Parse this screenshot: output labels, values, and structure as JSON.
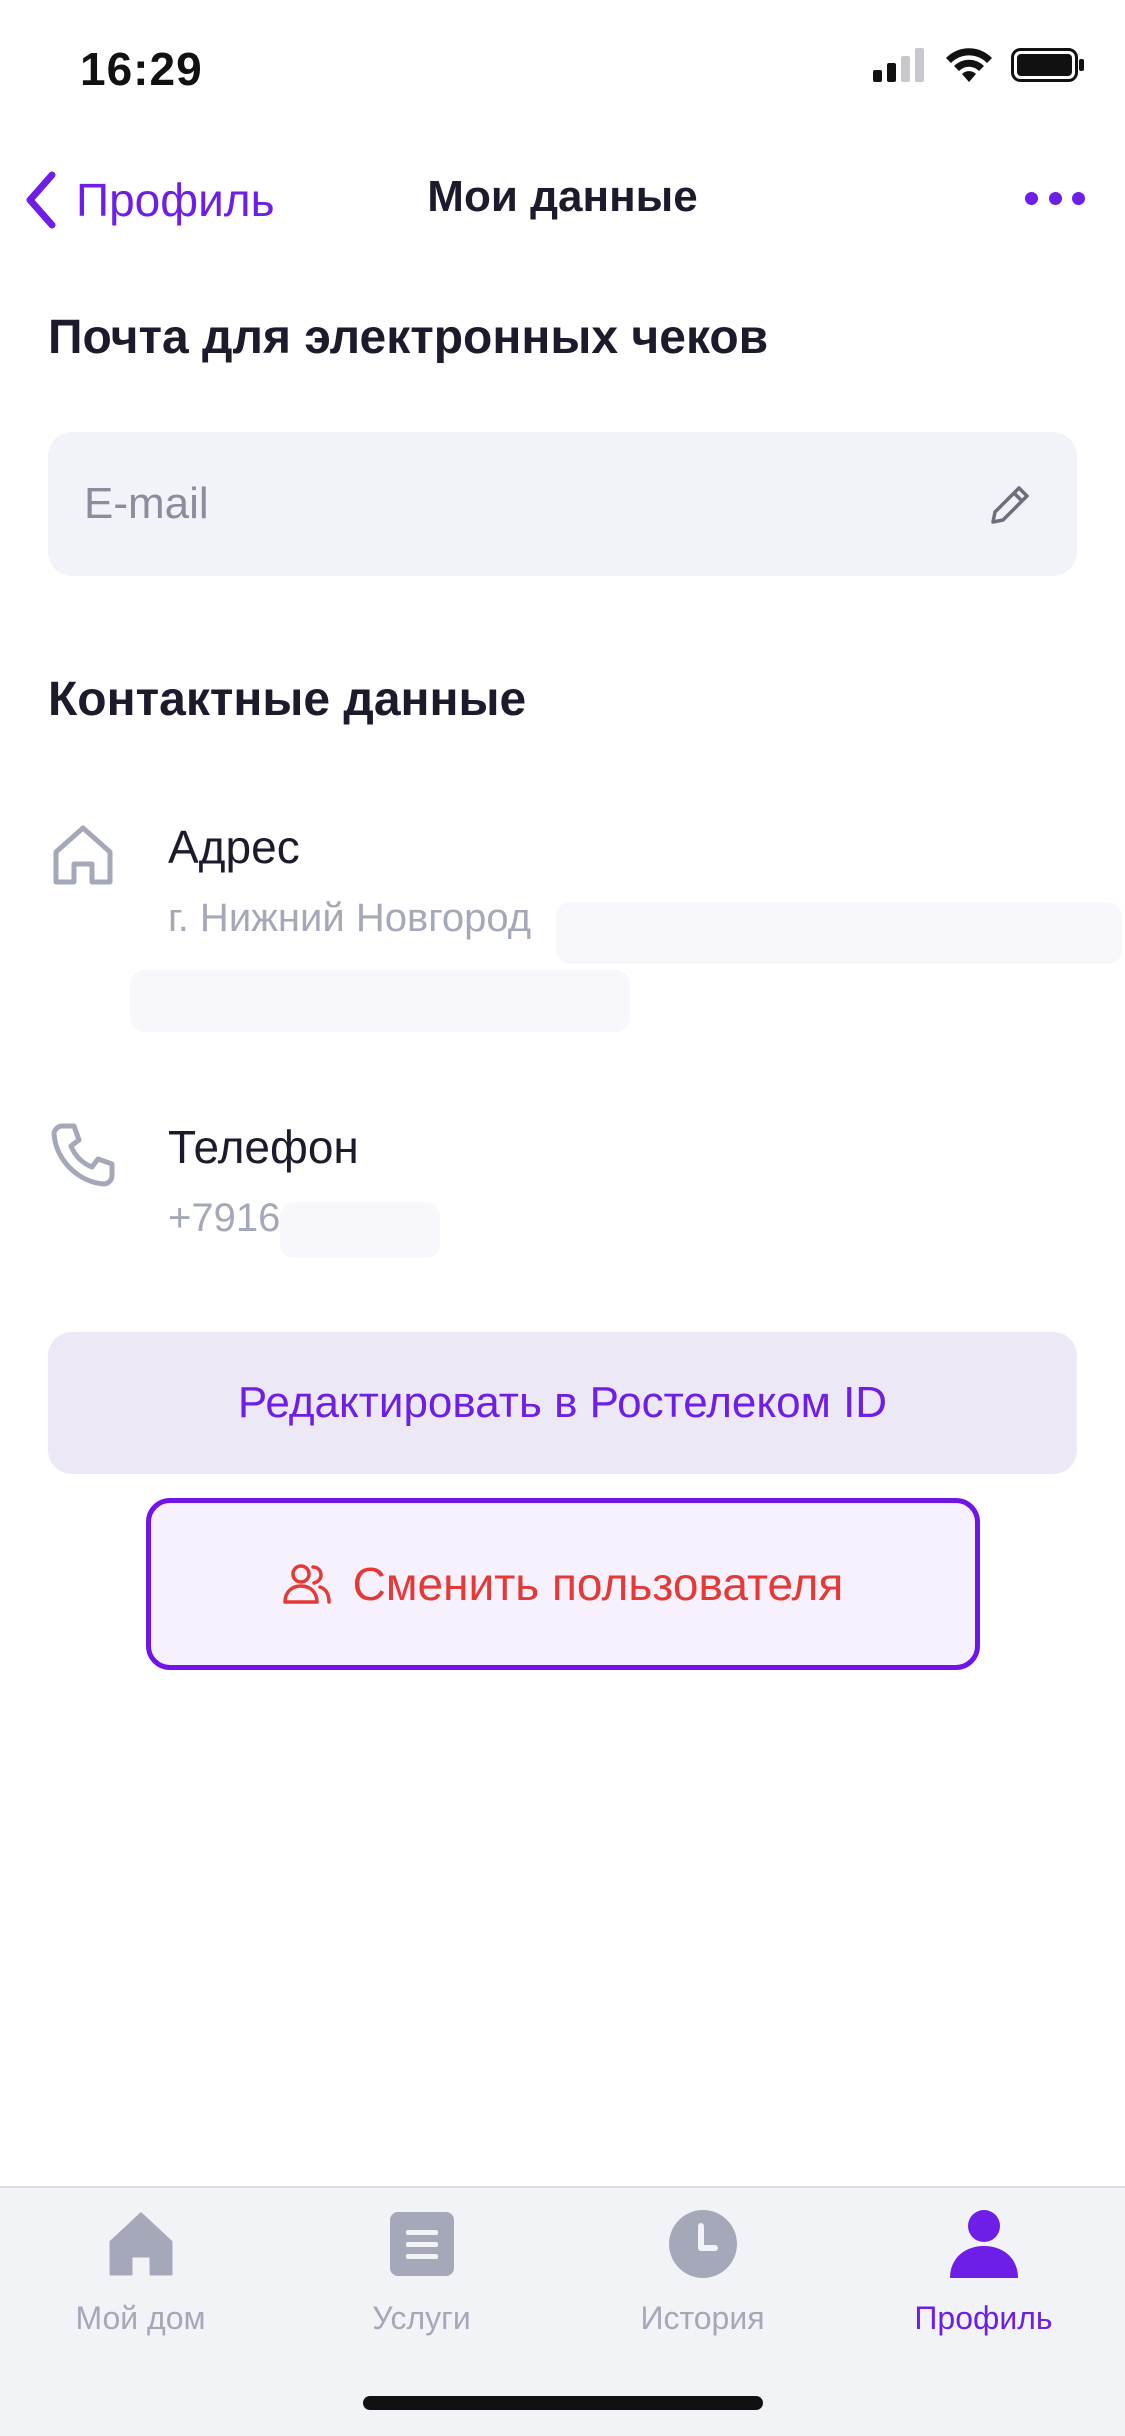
{
  "status_bar": {
    "time": "16:29"
  },
  "nav": {
    "back_label": "Профиль",
    "title": "Мои данные"
  },
  "receipts": {
    "title": "Почта для электронных чеков",
    "email_placeholder": "E-mail"
  },
  "contacts": {
    "title": "Контактные данные",
    "address_label": "Адрес",
    "address_value": "г. Нижний Новгород",
    "phone_label": "Телефон",
    "phone_value": "+7916"
  },
  "actions": {
    "edit_id_label": "Редактировать в Ростелеком ID",
    "switch_user_label": "Сменить пользователя"
  },
  "tabs": [
    {
      "label": "Мой дом",
      "icon": "home-icon",
      "active": false
    },
    {
      "label": "Услуги",
      "icon": "services-icon",
      "active": false
    },
    {
      "label": "История",
      "icon": "clock-icon",
      "active": false
    },
    {
      "label": "Профиль",
      "icon": "profile-icon",
      "active": true
    }
  ],
  "colors": {
    "accent": "#6e1ee6",
    "danger": "#e53935",
    "muted": "#a5a8b8",
    "field_bg": "#f2f3f8"
  }
}
